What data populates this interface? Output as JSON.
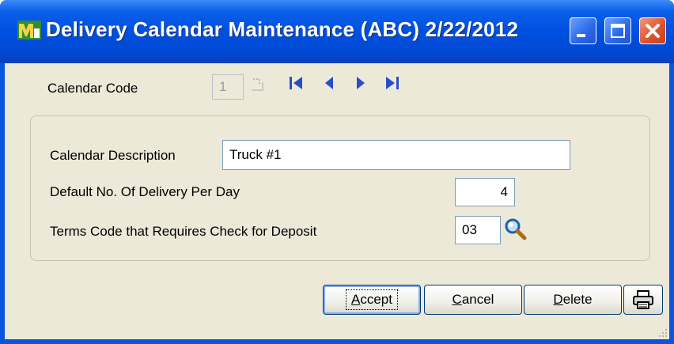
{
  "window": {
    "title": "Delivery Calendar Maintenance (ABC) 2/22/2012",
    "app_icon": "sage-mas90-icon"
  },
  "form": {
    "calendar_code_label": "Calendar Code",
    "calendar_code_value": "1",
    "calendar_description_label": "Calendar Description",
    "calendar_description_value": "Truck #1",
    "default_deliveries_label": "Default No. Of Delivery Per Day",
    "default_deliveries_value": "4",
    "terms_code_label": "Terms Code that Requires Check for Deposit",
    "terms_code_value": "03"
  },
  "buttons": {
    "accept_first": "A",
    "accept_rest": "ccept",
    "cancel_first": "C",
    "cancel_rest": "ancel",
    "delete_first": "D",
    "delete_rest": "elete"
  },
  "colors": {
    "titlebar": "#0050e0",
    "client_bg": "#ece9d8",
    "nav_arrows": "#2a4ec8"
  }
}
